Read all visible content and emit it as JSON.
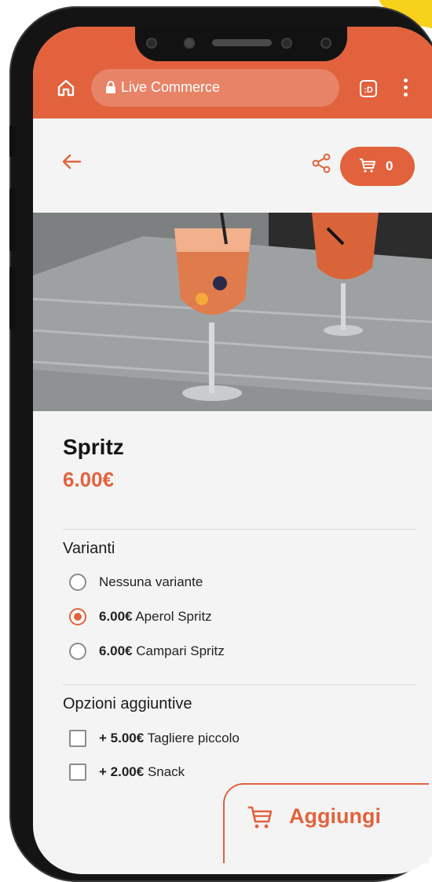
{
  "browser": {
    "url_label": "Live Commerce",
    "tabs_label": ":D"
  },
  "header": {
    "cart_count": "0"
  },
  "product": {
    "title": "Spritz",
    "price": "6.00€"
  },
  "variants": {
    "title": "Varianti",
    "options": [
      {
        "price": "",
        "label": "Nessuna variante",
        "selected": false
      },
      {
        "price": "6.00€",
        "label": "Aperol Spritz",
        "selected": true
      },
      {
        "price": "6.00€",
        "label": "Campari Spritz",
        "selected": false
      }
    ]
  },
  "extras": {
    "title": "Opzioni aggiuntive",
    "options": [
      {
        "price": "+ 5.00€",
        "label": "Tagliere piccolo",
        "checked": false
      },
      {
        "price": "+ 2.00€",
        "label": "Snack",
        "checked": false
      }
    ]
  },
  "footer": {
    "add_label": "Aggiungi"
  },
  "colors": {
    "accent": "#e1623d",
    "background": "#f4f4f4",
    "phone_frame": "#141414",
    "corner_blob": "#f7d21c"
  }
}
